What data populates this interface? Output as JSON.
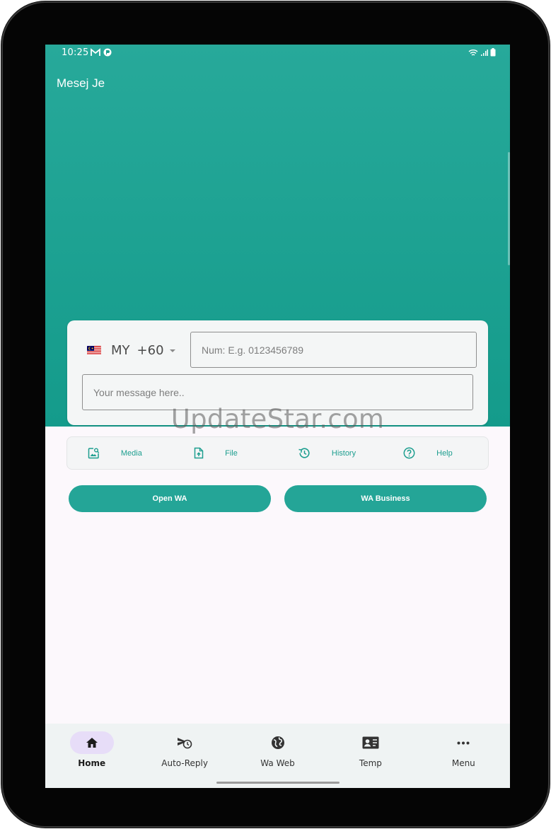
{
  "status_bar": {
    "time": "10:25"
  },
  "app": {
    "title": "Mesej Je"
  },
  "form": {
    "country_code": "MY",
    "dial_code": "+60",
    "number_placeholder": "Num: E.g. 0123456789",
    "message_placeholder": "Your message here.."
  },
  "watermark": "UpdateStar.com",
  "actions": [
    {
      "label": "Media",
      "icon": "image-search-icon"
    },
    {
      "label": "File",
      "icon": "file-upload-icon"
    },
    {
      "label": "History",
      "icon": "history-icon"
    },
    {
      "label": "Help",
      "icon": "help-circle-icon"
    }
  ],
  "buttons": {
    "open_wa": "Open WA",
    "wa_business": "WA Business"
  },
  "bottom_nav": [
    {
      "label": "Home",
      "icon": "home-icon",
      "active": true
    },
    {
      "label": "Auto-Reply",
      "icon": "send-clock-icon",
      "active": false
    },
    {
      "label": "Wa Web",
      "icon": "globe-icon",
      "active": false
    },
    {
      "label": "Temp",
      "icon": "contact-card-icon",
      "active": false
    },
    {
      "label": "Menu",
      "icon": "more-horizontal-icon",
      "active": false
    }
  ],
  "colors": {
    "accent": "#24a597",
    "header_top": "#27a99a",
    "header_bottom": "#149b8b",
    "nav_pill": "#e7ddf8"
  }
}
